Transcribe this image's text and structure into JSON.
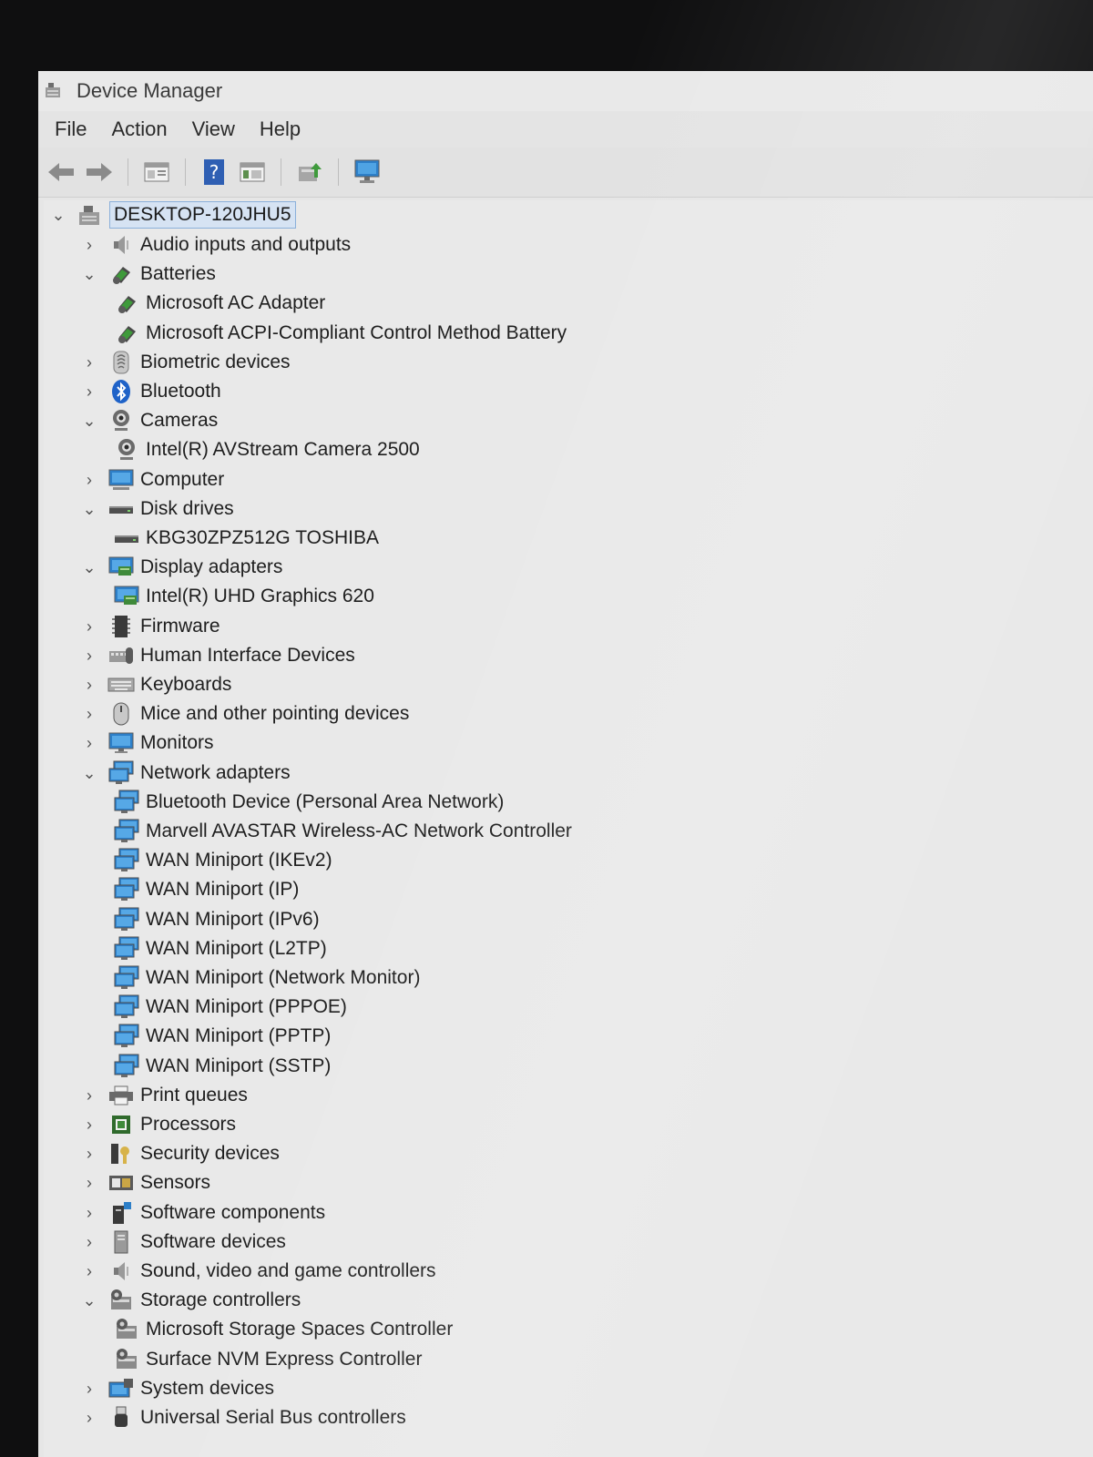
{
  "window": {
    "title": "Device Manager"
  },
  "menu": [
    "File",
    "Action",
    "View",
    "Help"
  ],
  "toolbar": [
    "back-arrow-icon",
    "forward-arrow-icon",
    "properties-icon",
    "help-icon",
    "show-hide-console-icon",
    "update-driver-icon",
    "monitor-scan-icon"
  ],
  "tree": {
    "root": "DESKTOP-120JHU5",
    "nodes": [
      {
        "label": "Audio inputs and outputs",
        "level": 1,
        "expanded": false,
        "icon": "speaker-icon"
      },
      {
        "label": "Batteries",
        "level": 1,
        "expanded": true,
        "icon": "battery-icon"
      },
      {
        "label": "Microsoft AC Adapter",
        "level": 2,
        "icon": "battery-icon"
      },
      {
        "label": "Microsoft ACPI-Compliant Control Method Battery",
        "level": 2,
        "icon": "battery-icon"
      },
      {
        "label": "Biometric devices",
        "level": 1,
        "expanded": false,
        "icon": "fingerprint-icon"
      },
      {
        "label": "Bluetooth",
        "level": 1,
        "expanded": false,
        "icon": "bluetooth-icon"
      },
      {
        "label": "Cameras",
        "level": 1,
        "expanded": true,
        "icon": "camera-icon"
      },
      {
        "label": "Intel(R) AVStream Camera 2500",
        "level": 2,
        "icon": "camera-icon"
      },
      {
        "label": "Computer",
        "level": 1,
        "expanded": false,
        "icon": "computer-icon"
      },
      {
        "label": "Disk drives",
        "level": 1,
        "expanded": true,
        "icon": "disk-drive-icon"
      },
      {
        "label": "KBG30ZPZ512G TOSHIBA",
        "level": 2,
        "icon": "disk-drive-icon"
      },
      {
        "label": "Display adapters",
        "level": 1,
        "expanded": true,
        "icon": "display-adapter-icon"
      },
      {
        "label": "Intel(R) UHD Graphics 620",
        "level": 2,
        "icon": "display-adapter-icon"
      },
      {
        "label": "Firmware",
        "level": 1,
        "expanded": false,
        "icon": "firmware-icon"
      },
      {
        "label": "Human Interface Devices",
        "level": 1,
        "expanded": false,
        "icon": "hid-icon"
      },
      {
        "label": "Keyboards",
        "level": 1,
        "expanded": false,
        "icon": "keyboard-icon"
      },
      {
        "label": "Mice and other pointing devices",
        "level": 1,
        "expanded": false,
        "icon": "mouse-icon"
      },
      {
        "label": "Monitors",
        "level": 1,
        "expanded": false,
        "icon": "monitor-icon"
      },
      {
        "label": "Network adapters",
        "level": 1,
        "expanded": true,
        "icon": "network-adapter-icon"
      },
      {
        "label": "Bluetooth Device (Personal Area Network)",
        "level": 2,
        "icon": "network-adapter-icon"
      },
      {
        "label": "Marvell AVASTAR Wireless-AC Network Controller",
        "level": 2,
        "icon": "network-adapter-icon"
      },
      {
        "label": "WAN Miniport (IKEv2)",
        "level": 2,
        "icon": "network-adapter-icon"
      },
      {
        "label": "WAN Miniport (IP)",
        "level": 2,
        "icon": "network-adapter-icon"
      },
      {
        "label": "WAN Miniport (IPv6)",
        "level": 2,
        "icon": "network-adapter-icon"
      },
      {
        "label": "WAN Miniport (L2TP)",
        "level": 2,
        "icon": "network-adapter-icon"
      },
      {
        "label": "WAN Miniport (Network Monitor)",
        "level": 2,
        "icon": "network-adapter-icon"
      },
      {
        "label": "WAN Miniport (PPPOE)",
        "level": 2,
        "icon": "network-adapter-icon"
      },
      {
        "label": "WAN Miniport (PPTP)",
        "level": 2,
        "icon": "network-adapter-icon"
      },
      {
        "label": "WAN Miniport (SSTP)",
        "level": 2,
        "icon": "network-adapter-icon"
      },
      {
        "label": "Print queues",
        "level": 1,
        "expanded": false,
        "icon": "printer-icon"
      },
      {
        "label": "Processors",
        "level": 1,
        "expanded": false,
        "icon": "processor-icon"
      },
      {
        "label": "Security devices",
        "level": 1,
        "expanded": false,
        "icon": "security-icon"
      },
      {
        "label": "Sensors",
        "level": 1,
        "expanded": false,
        "icon": "sensor-icon"
      },
      {
        "label": "Software components",
        "level": 1,
        "expanded": false,
        "icon": "software-component-icon"
      },
      {
        "label": "Software devices",
        "level": 1,
        "expanded": false,
        "icon": "software-device-icon"
      },
      {
        "label": "Sound, video and game controllers",
        "level": 1,
        "expanded": false,
        "icon": "speaker-icon"
      },
      {
        "label": "Storage controllers",
        "level": 1,
        "expanded": true,
        "icon": "storage-controller-icon"
      },
      {
        "label": "Microsoft Storage Spaces Controller",
        "level": 2,
        "icon": "storage-controller-icon"
      },
      {
        "label": "Surface NVM Express Controller",
        "level": 2,
        "icon": "storage-controller-icon"
      },
      {
        "label": "System devices",
        "level": 1,
        "expanded": false,
        "icon": "system-device-icon"
      },
      {
        "label": "Universal Serial Bus controllers",
        "level": 1,
        "expanded": false,
        "icon": "usb-icon"
      }
    ]
  }
}
